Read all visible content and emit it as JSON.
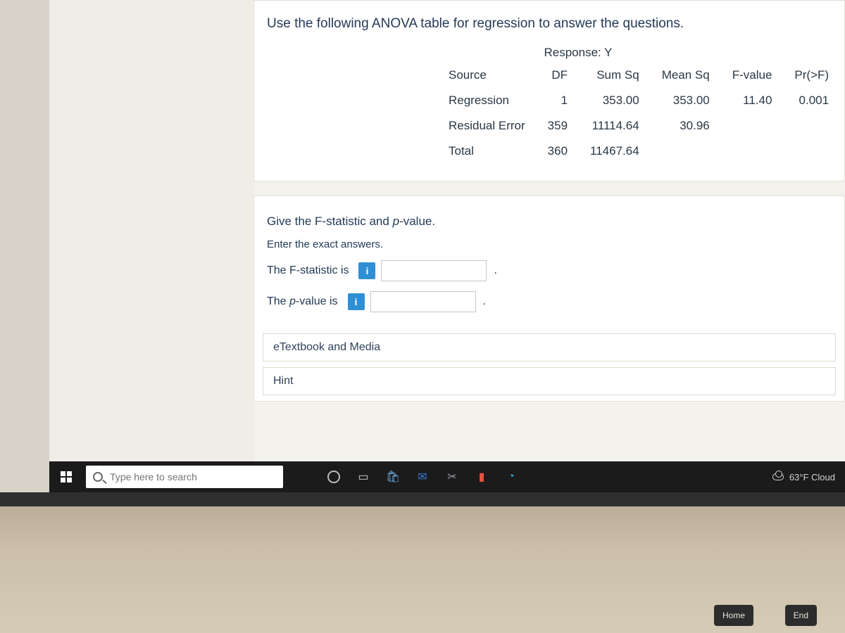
{
  "question": {
    "prompt": "Use the following ANOVA table for regression to answer the questions."
  },
  "anova": {
    "response_label": "Response: Y",
    "headers": {
      "source": "Source",
      "df": "DF",
      "sumsq": "Sum Sq",
      "meansq": "Mean Sq",
      "fvalue": "F-value",
      "prf": "Pr(>F)"
    },
    "rows": {
      "regression": {
        "source": "Regression",
        "df": "1",
        "sumsq": "353.00",
        "meansq": "353.00",
        "fvalue": "11.40",
        "prf": "0.001"
      },
      "residual": {
        "source": "Residual Error",
        "df": "359",
        "sumsq": "11114.64",
        "meansq": "30.96",
        "fvalue": "",
        "prf": ""
      },
      "total": {
        "source": "Total",
        "df": "360",
        "sumsq": "11467.64",
        "meansq": "",
        "fvalue": "",
        "prf": ""
      }
    }
  },
  "answer": {
    "heading_1": "Give the F-statistic and ",
    "heading_italic": "p",
    "heading_2": "-value.",
    "instr": "Enter the exact answers.",
    "fstat_label": "The F-statistic is",
    "pval_label_pre": "The ",
    "pval_label_italic": "p",
    "pval_label_post": "-value is",
    "info_glyph": "i",
    "period": "."
  },
  "buttons": {
    "etext": "eTextbook and Media",
    "hint": "Hint"
  },
  "taskbar": {
    "search_placeholder": "Type here to search",
    "weather": "63°F Cloud"
  },
  "deck": {
    "key_left": "Home",
    "key_right": "End"
  }
}
